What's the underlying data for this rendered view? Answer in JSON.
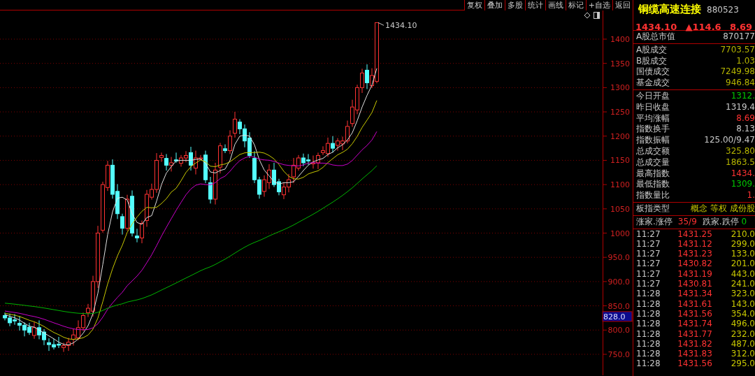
{
  "toolbar": {
    "buttons": [
      "复权",
      "叠加",
      "多股",
      "统计",
      "画线",
      "标记",
      "+自选",
      "返回"
    ]
  },
  "chart": {
    "price_label": "1434.10",
    "y_axis_labels": [
      "1400",
      "1350",
      "1300",
      "1250",
      "1200",
      "1150",
      "1100",
      "1050",
      "1000",
      "950.0",
      "900.0",
      "850.0",
      "800.0",
      "750.0"
    ],
    "cursor_value": "828.0"
  },
  "quote": {
    "name": "铜缆高速连接",
    "code": "880523",
    "price": "1434.10",
    "change": "▲114.6",
    "change_pct": "8.69"
  },
  "market_value": {
    "label": "A股总市值",
    "value": "870177"
  },
  "turnover_rows": [
    {
      "label": "A股成交",
      "value": "7703.57",
      "color": "#b4b400"
    },
    {
      "label": "B股成交",
      "value": "1.03",
      "color": "#b4b400"
    },
    {
      "label": "国债成交",
      "value": "7249.98",
      "color": "#b4b400"
    },
    {
      "label": "基金成交",
      "value": "946.84",
      "color": "#b4b400"
    }
  ],
  "stats_rows": [
    {
      "label": "今日开盘",
      "value": "1312.",
      "color": "#00c800"
    },
    {
      "label": "昨日收盘",
      "value": "1319.4",
      "color": "#c8c8c8"
    },
    {
      "label": "平均涨幅",
      "value": "8.69",
      "color": "#ff3232"
    },
    {
      "label": "指数换手",
      "value": "8.13",
      "color": "#c8c8c8"
    },
    {
      "label": "指数振幅",
      "value": "125.00/9.47",
      "color": "#c8c8c8"
    },
    {
      "label": "总成交额",
      "value": "325.80",
      "color": "#b4b400"
    },
    {
      "label": "总成交量",
      "value": "1863.5",
      "color": "#b4b400"
    },
    {
      "label": "最高指数",
      "value": "1434.",
      "color": "#ff3232"
    },
    {
      "label": "最低指数",
      "value": "1309.",
      "color": "#00c800"
    },
    {
      "label": "指数量比",
      "value": "1.",
      "color": "#ff3232"
    }
  ],
  "index_type": {
    "label": "板指类型",
    "value": "概念 等权 成份股"
  },
  "breadth": {
    "up_label": "涨家.涨停",
    "up_value": "35/9",
    "down_label": "跌家.跌停",
    "down_value": "0"
  },
  "ticks": [
    {
      "time": "11:27",
      "price": "1431.25",
      "volume": "210.0"
    },
    {
      "time": "11:27",
      "price": "1431.12",
      "volume": "299.0"
    },
    {
      "time": "11:27",
      "price": "1431.23",
      "volume": "133.0"
    },
    {
      "time": "11:27",
      "price": "1430.82",
      "volume": "201.0"
    },
    {
      "time": "11:27",
      "price": "1431.19",
      "volume": "443.0"
    },
    {
      "time": "11:27",
      "price": "1430.81",
      "volume": "241.0"
    },
    {
      "time": "11:28",
      "price": "1431.34",
      "volume": "323.0"
    },
    {
      "time": "11:28",
      "price": "1431.61",
      "volume": "143.0"
    },
    {
      "time": "11:28",
      "price": "1431.56",
      "volume": "354.0"
    },
    {
      "time": "11:28",
      "price": "1431.74",
      "volume": "496.0"
    },
    {
      "time": "11:28",
      "price": "1431.77",
      "volume": "232.0"
    },
    {
      "time": "11:28",
      "price": "1431.82",
      "volume": "487.0"
    },
    {
      "time": "11:28",
      "price": "1431.83",
      "volume": "312.0"
    },
    {
      "time": "11:28",
      "price": "1431.56",
      "volume": "295.0"
    }
  ]
}
